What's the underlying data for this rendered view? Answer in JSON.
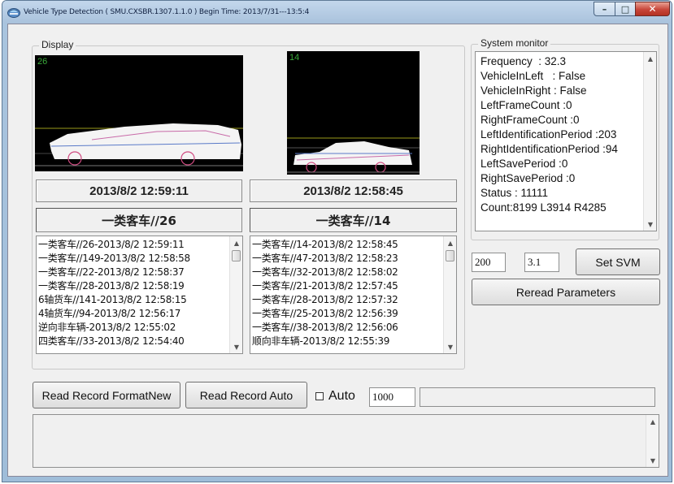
{
  "window": {
    "title": "Vehicle Type Detection ( SMU.CXSBR.1307.1.1.0 ) Begin Time: 2013/7/31---13:5:4",
    "minimize_icon": "minimize-icon",
    "maximize_icon": "maximize-icon",
    "close_icon": "close-icon"
  },
  "display": {
    "legend": "Display",
    "left": {
      "frame_number": "26",
      "date": "2013/8/2 12:59:11",
      "type": "一类客车//26",
      "records": [
        "一类客车//26-2013/8/2 12:59:11",
        "一类客车//149-2013/8/2 12:58:58",
        "一类客车//22-2013/8/2 12:58:37",
        "一类客车//28-2013/8/2 12:58:19",
        "6轴货车//141-2013/8/2 12:58:15",
        "4轴货车//94-2013/8/2 12:56:17",
        "逆向非车辆-2013/8/2 12:55:02",
        "四类客车//33-2013/8/2 12:54:40"
      ]
    },
    "right": {
      "frame_number": "14",
      "date": "2013/8/2 12:58:45",
      "type": "一类客车//14",
      "records": [
        "一类客车//14-2013/8/2 12:58:45",
        "一类客车//47-2013/8/2 12:58:23",
        "一类客车//32-2013/8/2 12:58:02",
        "一类客车//21-2013/8/2 12:57:45",
        "一类客车//28-2013/8/2 12:57:32",
        "一类客车//25-2013/8/2 12:56:39",
        "一类客车//38-2013/8/2 12:56:06",
        "顺向非车辆-2013/8/2 12:55:39"
      ]
    }
  },
  "monitor": {
    "legend": "System monitor",
    "lines": [
      "Frequency  : 32.3",
      "VehicleInLeft   : False",
      "VehicleInRight : False",
      "LeftFrameCount :0",
      "RightFrameCount :0",
      "LeftIdentificationPeriod :203",
      "RightIdentificationPeriod :94",
      "LeftSavePeriod :0",
      "RightSavePeriod :0",
      "Status : 11111",
      "Count:8199 L3914 R4285"
    ]
  },
  "svm": {
    "param1": "200",
    "param2": "3.1",
    "set_label": "Set SVM",
    "reread_label": "Reread Parameters"
  },
  "bottom": {
    "read_format_label": "Read Record FormatNew",
    "read_auto_label": "Read Record Auto",
    "auto_label": "Auto",
    "auto_checked": false,
    "interval": "1000",
    "status_text": "",
    "log_text": ""
  },
  "colors": {
    "title_bar": "#b3cbe4",
    "close_button": "#c8463a",
    "video_bg": "#000000",
    "frame_number": "#3aa83a"
  }
}
